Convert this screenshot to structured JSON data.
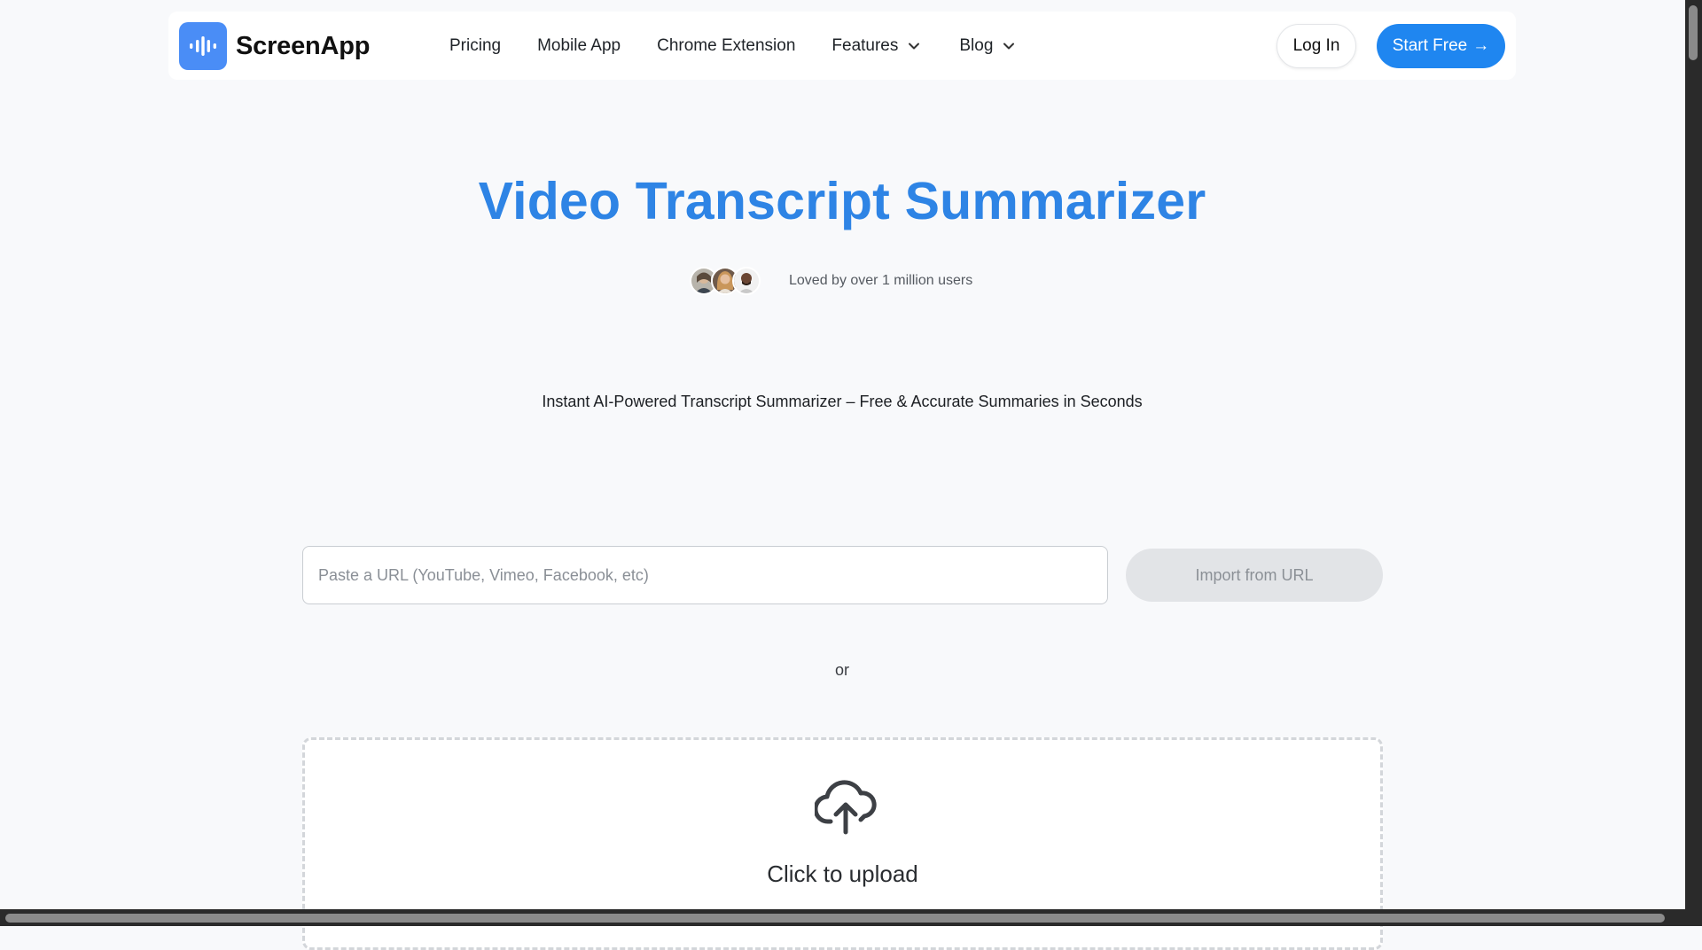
{
  "brand": {
    "name": "ScreenApp",
    "logo_icon": "audio-waveform-icon",
    "accent_color": "#4a8df6"
  },
  "nav": {
    "items": [
      {
        "label": "Pricing",
        "has_dropdown": false
      },
      {
        "label": "Mobile App",
        "has_dropdown": false
      },
      {
        "label": "Chrome Extension",
        "has_dropdown": false
      },
      {
        "label": "Features",
        "has_dropdown": true
      },
      {
        "label": "Blog",
        "has_dropdown": true
      }
    ]
  },
  "header_actions": {
    "login_label": "Log In",
    "start_label": "Start Free",
    "start_arrow": "→",
    "start_color": "#1f86f0"
  },
  "hero": {
    "title": "Video Transcript Summarizer",
    "title_color": "#2e84e5",
    "social_proof": "Loved by over 1 million users",
    "subtitle": "Instant AI-Powered Transcript Summarizer – Free & Accurate Summaries in Seconds"
  },
  "url_import": {
    "placeholder": "Paste a URL (YouTube, Vimeo, Facebook, etc)",
    "value": "",
    "button_label": "Import from URL"
  },
  "divider_text": "or",
  "upload": {
    "label": "Click to upload",
    "icon": "cloud-upload-icon"
  }
}
